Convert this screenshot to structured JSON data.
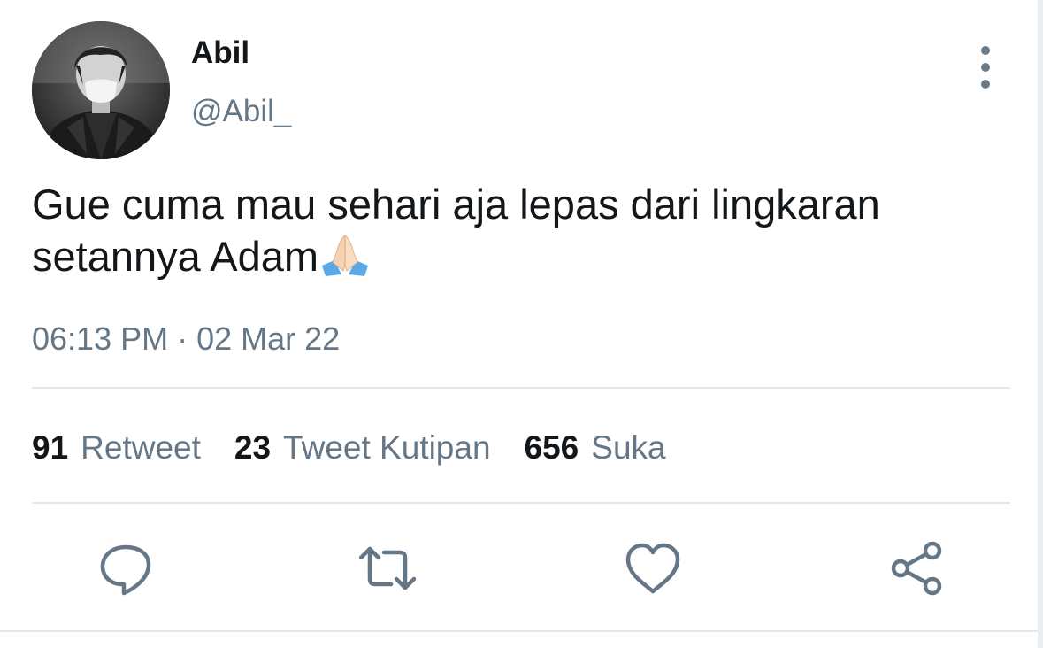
{
  "user": {
    "display_name": "Abil",
    "handle": "@Abil_"
  },
  "tweet": {
    "text": "Gue cuma mau sehari aja lepas dari lingkaran setannya Adam",
    "emoji": "folded-hands",
    "timestamp": "06:13 PM · 02 Mar 22"
  },
  "stats": [
    {
      "count": "91",
      "label": "Retweet"
    },
    {
      "count": "23",
      "label": "Tweet Kutipan"
    },
    {
      "count": "656",
      "label": "Suka"
    }
  ],
  "actions": [
    "reply-icon",
    "retweet-icon",
    "like-icon",
    "share-icon"
  ],
  "colors": {
    "text_primary": "#14171a",
    "text_secondary": "#657786",
    "icon": "#657786",
    "divider": "#e3e7eb"
  }
}
